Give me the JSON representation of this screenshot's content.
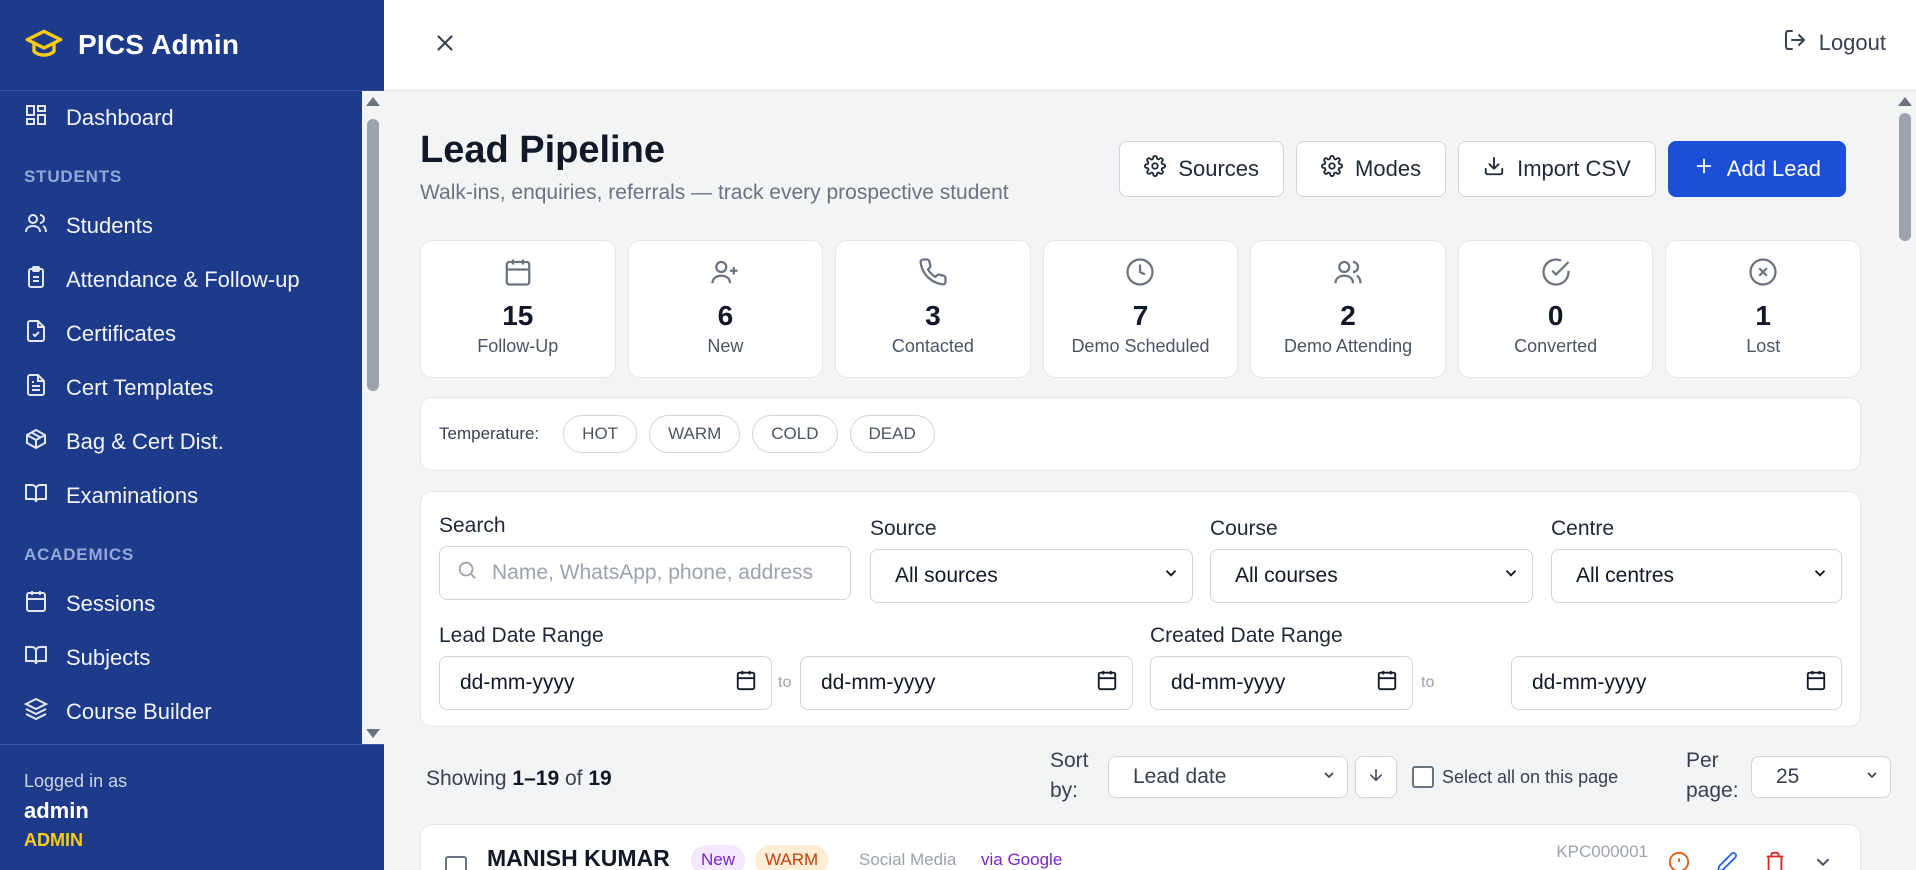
{
  "brand": {
    "title": "PICS Admin",
    "icon": "graduation-cap-icon",
    "accent": "#facc15"
  },
  "sidebar": {
    "bg": "#1e3a8a",
    "items": [
      {
        "label": "Dashboard",
        "icon": "dashboard-icon"
      },
      {
        "section": "STUDENTS"
      },
      {
        "label": "Students",
        "icon": "users-icon"
      },
      {
        "label": "Attendance & Follow-up",
        "icon": "clipboard-icon"
      },
      {
        "label": "Certificates",
        "icon": "file-check-icon"
      },
      {
        "label": "Cert Templates",
        "icon": "file-text-icon"
      },
      {
        "label": "Bag & Cert Dist.",
        "icon": "package-icon"
      },
      {
        "label": "Examinations",
        "icon": "book-open-icon"
      },
      {
        "section": "ACADEMICS"
      },
      {
        "label": "Sessions",
        "icon": "calendar-icon"
      },
      {
        "label": "Subjects",
        "icon": "book-open-icon"
      },
      {
        "label": "Course Builder",
        "icon": "layers-icon"
      }
    ],
    "user": {
      "logged_in_label": "Logged in as",
      "name": "admin",
      "role": "ADMIN"
    }
  },
  "topbar": {
    "logout_label": "Logout"
  },
  "page": {
    "title": "Lead Pipeline",
    "subtitle": "Walk-ins, enquiries, referrals — track every prospective student",
    "actions": {
      "sources": "Sources",
      "modes": "Modes",
      "import": "Import CSV",
      "add": "Add Lead"
    },
    "primary_color": "#1d4ed8"
  },
  "stats": [
    {
      "value": "15",
      "label": "Follow-Up",
      "icon": "calendar-icon"
    },
    {
      "value": "6",
      "label": "New",
      "icon": "user-plus-icon"
    },
    {
      "value": "3",
      "label": "Contacted",
      "icon": "phone-icon"
    },
    {
      "value": "7",
      "label": "Demo Scheduled",
      "icon": "clock-icon"
    },
    {
      "value": "2",
      "label": "Demo Attending",
      "icon": "users-icon"
    },
    {
      "value": "0",
      "label": "Converted",
      "icon": "check-circle-icon"
    },
    {
      "value": "1",
      "label": "Lost",
      "icon": "x-circle-icon"
    }
  ],
  "temperature": {
    "label": "Temperature:",
    "chips": [
      "HOT",
      "WARM",
      "COLD",
      "DEAD"
    ]
  },
  "filters": {
    "search_label": "Search",
    "search_placeholder": "Name, WhatsApp, phone, address",
    "source_label": "Source",
    "source_value": "All sources",
    "course_label": "Course",
    "course_value": "All courses",
    "centre_label": "Centre",
    "centre_value": "All centres",
    "lead_range_label": "Lead Date Range",
    "created_range_label": "Created Date Range",
    "date_placeholder": "dd-mm-yyyy",
    "to": "to"
  },
  "list": {
    "showing_prefix": "Showing",
    "range": "1–19",
    "of": "of",
    "total": "19",
    "sort_by_1": "Sort",
    "sort_by_2": "by:",
    "sort_value": "Lead date",
    "select_all": "Select all on this page",
    "per_page_1": "Per",
    "per_page_2": "page:",
    "per_page_value": "25"
  },
  "leads": [
    {
      "name": "MANISH KUMAR",
      "status": "New",
      "temperature": "WARM",
      "source": "Social Media",
      "via": "via Google",
      "code": "KPC000001"
    }
  ]
}
